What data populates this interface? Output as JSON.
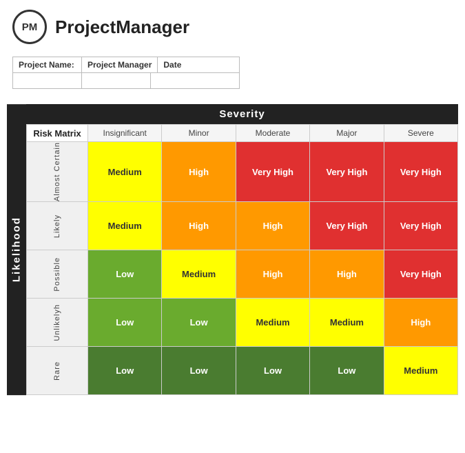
{
  "header": {
    "logo_text": "PM",
    "app_title": "ProjectManager"
  },
  "form": {
    "labels": [
      "Project Name:",
      "Project Manager",
      "Date"
    ],
    "values": [
      "",
      "",
      ""
    ]
  },
  "matrix": {
    "title": "Risk Matrix",
    "severity_label": "Severity",
    "likelihood_label": "Likelihood",
    "col_headers": [
      "Insignificant",
      "Minor",
      "Moderate",
      "Major",
      "Severe"
    ],
    "rows": [
      {
        "label": "Almost Certain",
        "cells": [
          {
            "text": "Medium",
            "color": "yellow"
          },
          {
            "text": "High",
            "color": "orange"
          },
          {
            "text": "Very High",
            "color": "red"
          },
          {
            "text": "Very High",
            "color": "red"
          },
          {
            "text": "Very High",
            "color": "red"
          }
        ]
      },
      {
        "label": "Likely",
        "cells": [
          {
            "text": "Medium",
            "color": "yellow"
          },
          {
            "text": "High",
            "color": "orange"
          },
          {
            "text": "High",
            "color": "orange"
          },
          {
            "text": "Very High",
            "color": "red"
          },
          {
            "text": "Very High",
            "color": "red"
          }
        ]
      },
      {
        "label": "Possible",
        "cells": [
          {
            "text": "Low",
            "color": "green"
          },
          {
            "text": "Medium",
            "color": "yellow"
          },
          {
            "text": "High",
            "color": "orange"
          },
          {
            "text": "High",
            "color": "orange"
          },
          {
            "text": "Very High",
            "color": "red"
          }
        ]
      },
      {
        "label": "Unlikelyh",
        "cells": [
          {
            "text": "Low",
            "color": "green"
          },
          {
            "text": "Low",
            "color": "green"
          },
          {
            "text": "Medium",
            "color": "yellow"
          },
          {
            "text": "Medium",
            "color": "yellow"
          },
          {
            "text": "High",
            "color": "orange"
          }
        ]
      },
      {
        "label": "Rare",
        "cells": [
          {
            "text": "Low",
            "color": "green-dark"
          },
          {
            "text": "Low",
            "color": "green-dark"
          },
          {
            "text": "Low",
            "color": "green-dark"
          },
          {
            "text": "Low",
            "color": "green-dark"
          },
          {
            "text": "Medium",
            "color": "yellow"
          }
        ]
      }
    ]
  }
}
